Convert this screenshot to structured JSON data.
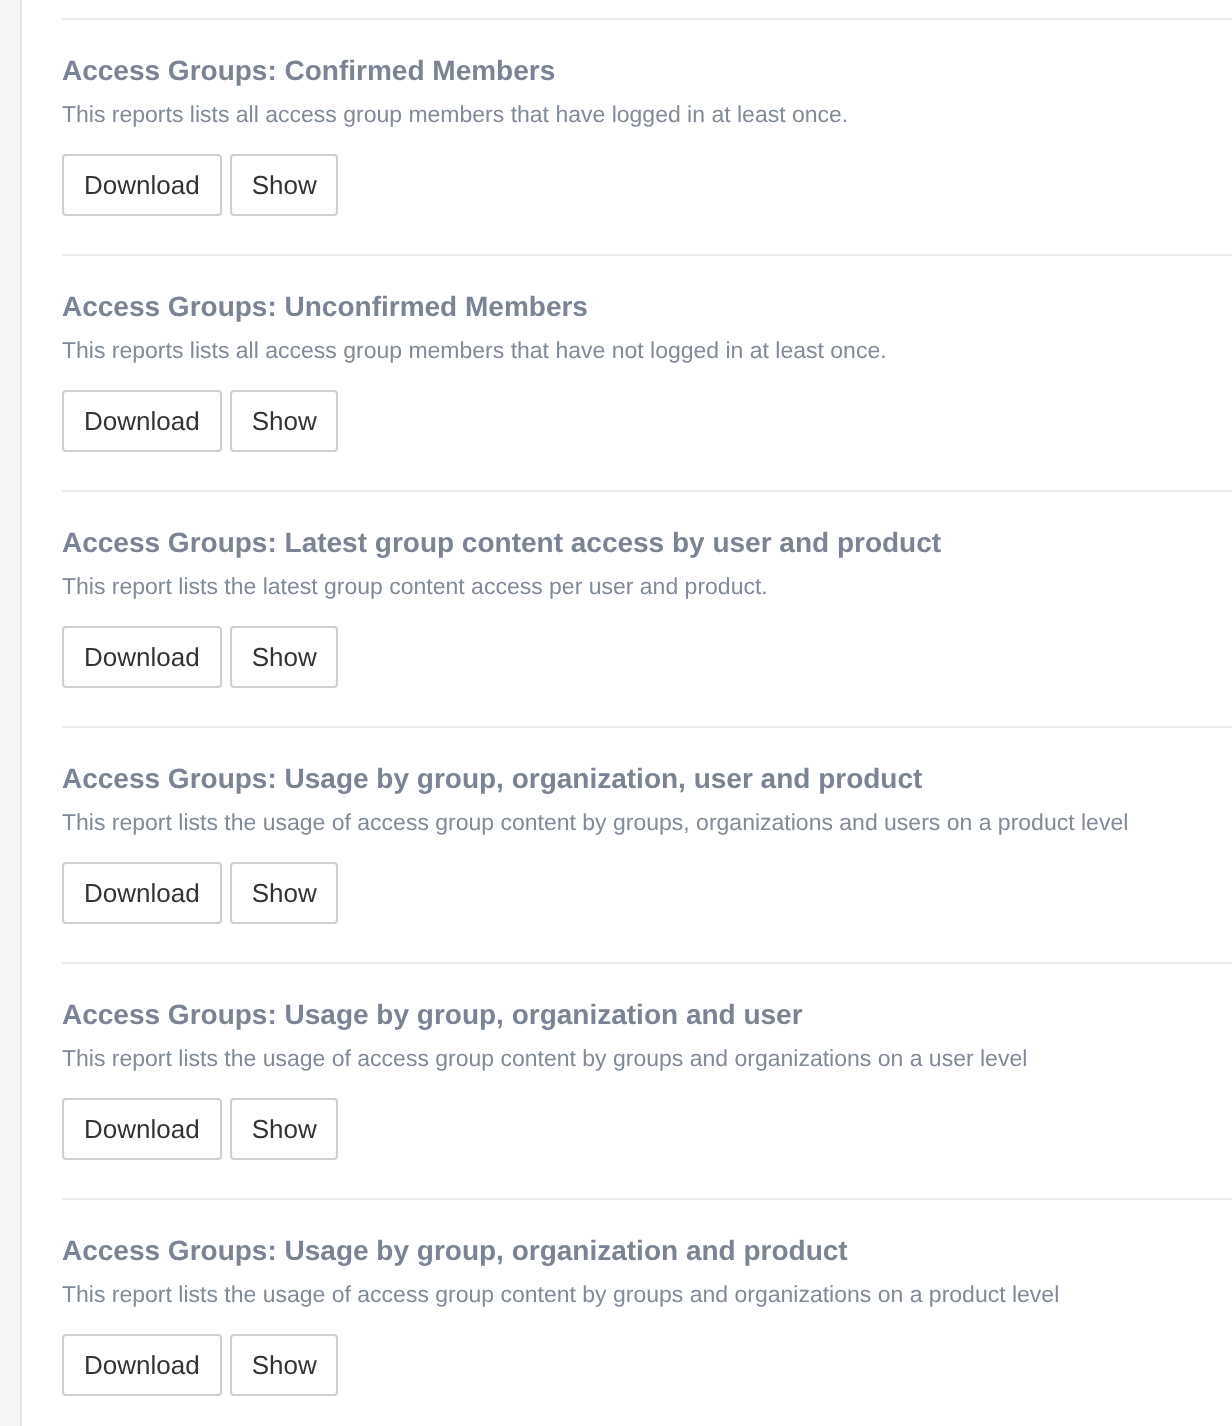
{
  "reports": [
    {
      "title": "Access Groups: Confirmed Members",
      "description": "This reports lists all access group members that have logged in at least once.",
      "buttons": [
        "Download",
        "Show"
      ]
    },
    {
      "title": "Access Groups: Unconfirmed Members",
      "description": "This reports lists all access group members that have not logged in at least once.",
      "buttons": [
        "Download",
        "Show"
      ]
    },
    {
      "title": "Access Groups: Latest group content access by user and product",
      "description": "This report lists the latest group content access per user and product.",
      "buttons": [
        "Download",
        "Show"
      ]
    },
    {
      "title": "Access Groups: Usage by group, organization, user and product",
      "description": "This report lists the usage of access group content by groups, organizations and users on a product level",
      "buttons": [
        "Download",
        "Show"
      ]
    },
    {
      "title": "Access Groups: Usage by group, organization and user",
      "description": "This report lists the usage of access group content by groups and organizations on a user level",
      "buttons": [
        "Download",
        "Show"
      ]
    },
    {
      "title": "Access Groups: Usage by group, organization and product",
      "description": "This report lists the usage of access group content by groups and organizations on a product level",
      "buttons": [
        "Download",
        "Show"
      ]
    }
  ]
}
